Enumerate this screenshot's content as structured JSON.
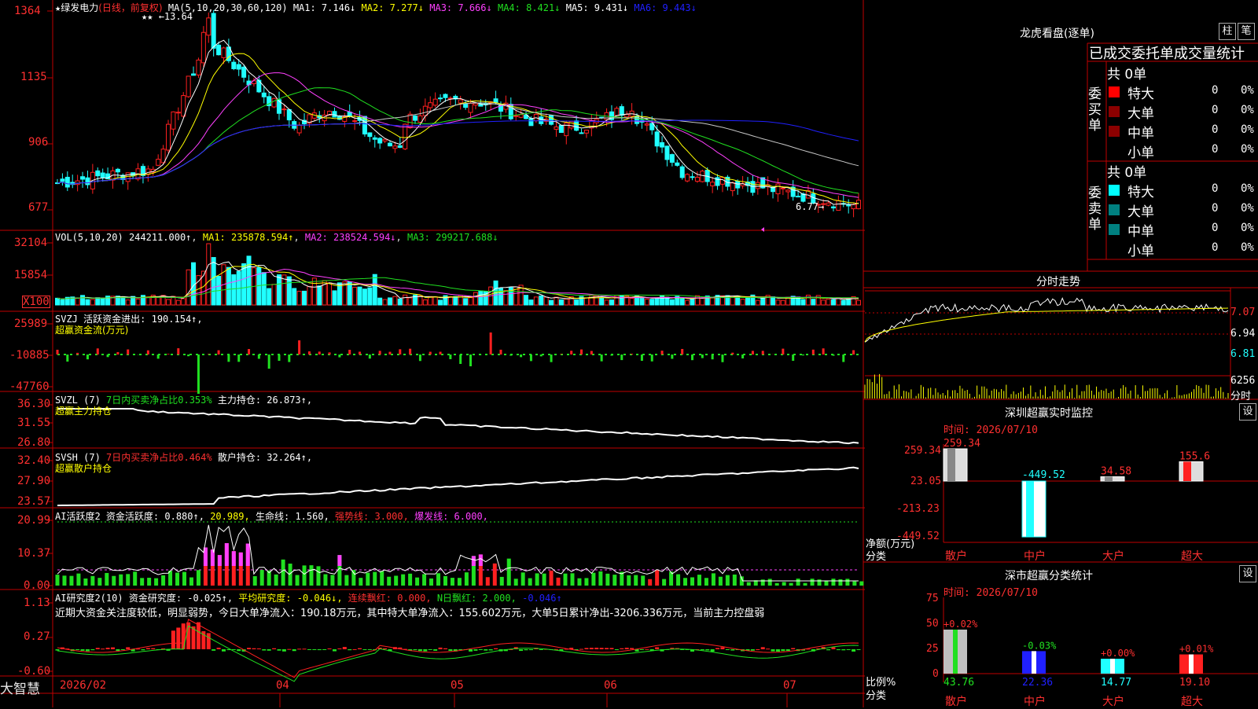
{
  "colors": {
    "up": "#ff2020",
    "down": "#20ffff",
    "white": "#ffffff",
    "yellow": "#ffff00",
    "magenta": "#ff40ff",
    "green": "#20e020",
    "blue": "#2020ff",
    "grid": "#c00000",
    "axis": "#ff3030"
  },
  "main": {
    "title_icon": "★",
    "stock_name": "绿发电力",
    "period": "(日线，前复权)",
    "ma_label": "MA(5,10,20,30,60,120)",
    "ma_values": [
      "MA1: 7.146↓",
      "MA2: 7.277↓",
      "MA3: 7.666↓",
      "MA4: 8.421↓",
      "MA5: 9.431↓",
      "MA6: 9.443↓"
    ],
    "y_ticks": [
      "1364",
      "1135",
      "906",
      "677"
    ],
    "high_mark": "←13.64",
    "low_mark": "6.77→",
    "stars": "★★"
  },
  "vol": {
    "label": "VOL(5,10,20)",
    "value": "244211.000↑",
    "ma1": "MA1: 235878.594↑",
    "ma2": "MA2: 238524.594↓",
    "ma3": "MA3: 299217.688↓",
    "y_ticks": [
      "32104",
      "15854",
      "X100"
    ]
  },
  "svzj": {
    "label": "SVZJ",
    "title": "活跃资金进出: 190.154↑,",
    "sub": "超赢资金流(万元)",
    "y_ticks": [
      "25989",
      "-10885",
      "-47760"
    ]
  },
  "svzl": {
    "label": "SVZL (7)",
    "ratio": "7日内买卖净占比0.353%",
    "hold": "主力持仓: 26.873↑,",
    "sub": "超赢主力持仓",
    "y_ticks": [
      "36.30",
      "31.55",
      "26.80"
    ]
  },
  "svsh": {
    "label": "SVSH (7)",
    "ratio": "7日内买卖净占比0.464%",
    "hold": "散户持仓: 32.264↑,",
    "sub": "超赢散户持仓",
    "y_ticks": [
      "32.40",
      "27.90",
      "23.57"
    ]
  },
  "ai2": {
    "label": "AI活跃度2",
    "a": "资金活跃度: 0.880↑,",
    "b": "20.989,",
    "c": "生命线: 1.560,",
    "d": "强势线: 3.000,",
    "e": "爆发线: 6.000,",
    "y_ticks": [
      "20.99",
      "10.37",
      "0.00"
    ]
  },
  "ai3": {
    "label": "AI研究度2(10)",
    "a": "资金研究度: -0.025↑,",
    "b": "平均研究度: -0.046↓,",
    "c": "连续飘红: 0.000,",
    "d": "N日飘红: 2.000,",
    "e": "-0.046↑",
    "summary": "近期大资金关注度较低，明显弱势，今日大单净流入：190.18万元，其中特大单净流入：155.602万元，大单5日累计净出-3206.336万元，当前主力控盘弱",
    "y_ticks": [
      "1.13",
      "0.27",
      "-0.60"
    ]
  },
  "xaxis": {
    "labels": [
      "2026/02",
      "04",
      "05",
      "06",
      "07"
    ]
  },
  "brand": "大智慧",
  "right": {
    "lhb_title": "龙虎看盘(逐单)",
    "btn_column": "柱",
    "btn_pen": "笔",
    "tabs": "已成交委托单成交量统计",
    "buy_label": "委买单",
    "sell_label": "委卖单",
    "buy_total": "共 0单",
    "sell_total": "共 0单",
    "rows": [
      {
        "name": "特大",
        "count": "0",
        "pct": "0%"
      },
      {
        "name": "大单",
        "count": "0",
        "pct": "0%"
      },
      {
        "name": "中单",
        "count": "0",
        "pct": "0%"
      },
      {
        "name": "小单",
        "count": "0",
        "pct": "0%"
      }
    ],
    "intraday_title": "分时走势",
    "intraday_ticks": [
      "7.07",
      "6.94",
      "6.81",
      "6256",
      "分时"
    ],
    "sz_title": "深圳超赢实时监控",
    "sz_time": "时间: 2026/07/10",
    "sz_ticks": [
      "259.34",
      "23.05",
      "-213.23",
      "-449.52"
    ],
    "sz_values": [
      "259.34",
      "-449.52",
      "34.58",
      "155.6"
    ],
    "sz_ylabel": "净额(万元)",
    "sz_xlabel": "分类",
    "cats": [
      "散户",
      "中户",
      "大户",
      "超大"
    ],
    "cls_title": "深市超赢分类统计",
    "cls_time": "时间: 2026/07/10",
    "cls_ticks": [
      "75",
      "50",
      "25",
      "0"
    ],
    "cls_changes": [
      "+0.02%",
      "-0.03%",
      "+0.00%",
      "+0.01%"
    ],
    "cls_values": [
      "43.76",
      "22.36",
      "14.77",
      "19.10"
    ],
    "cls_ylabel": "比例%",
    "settings": "设"
  },
  "chart_data": [
    {
      "type": "candlestick",
      "title": "绿发电力 (日线，前复权)",
      "x_range": [
        "2026/02",
        "2026/07"
      ],
      "ylim": [
        6.77,
        13.64
      ],
      "high": 13.64,
      "low": 6.77,
      "series_ma": {
        "MA1": 7.146,
        "MA2": 7.277,
        "MA3": 7.666,
        "MA4": 8.421,
        "MA5": 9.431,
        "MA6": 9.443
      }
    },
    {
      "type": "bar",
      "title": "VOL(5,10,20)",
      "values": {
        "VOL": 244211.0,
        "MA1": 235878.594,
        "MA2": 238524.594,
        "MA3": 299217.688
      }
    },
    {
      "type": "bar",
      "title": "SVZJ 活跃资金进出",
      "values": {
        "current": 190.154
      }
    },
    {
      "type": "line",
      "title": "SVZL (7)",
      "values": {
        "ratio_pct": 0.353,
        "hold": 26.873
      }
    },
    {
      "type": "line",
      "title": "SVSH (7)",
      "values": {
        "ratio_pct": 0.464,
        "hold": 32.264
      }
    },
    {
      "type": "bar",
      "title": "深圳超赢实时监控",
      "categories": [
        "散户",
        "中户",
        "大户",
        "超大"
      ],
      "values": [
        259.34,
        -449.52,
        34.58,
        155.6
      ],
      "ylim": [
        -449.52,
        259.34
      ]
    },
    {
      "type": "bar",
      "title": "深市超赢分类统计",
      "categories": [
        "散户",
        "中户",
        "大户",
        "超大"
      ],
      "values": [
        43.76,
        22.36,
        14.77,
        19.1
      ],
      "changes": [
        "+0.02%",
        "-0.03%",
        "+0.00%",
        "+0.01%"
      ],
      "ylim": [
        0,
        75
      ]
    }
  ]
}
